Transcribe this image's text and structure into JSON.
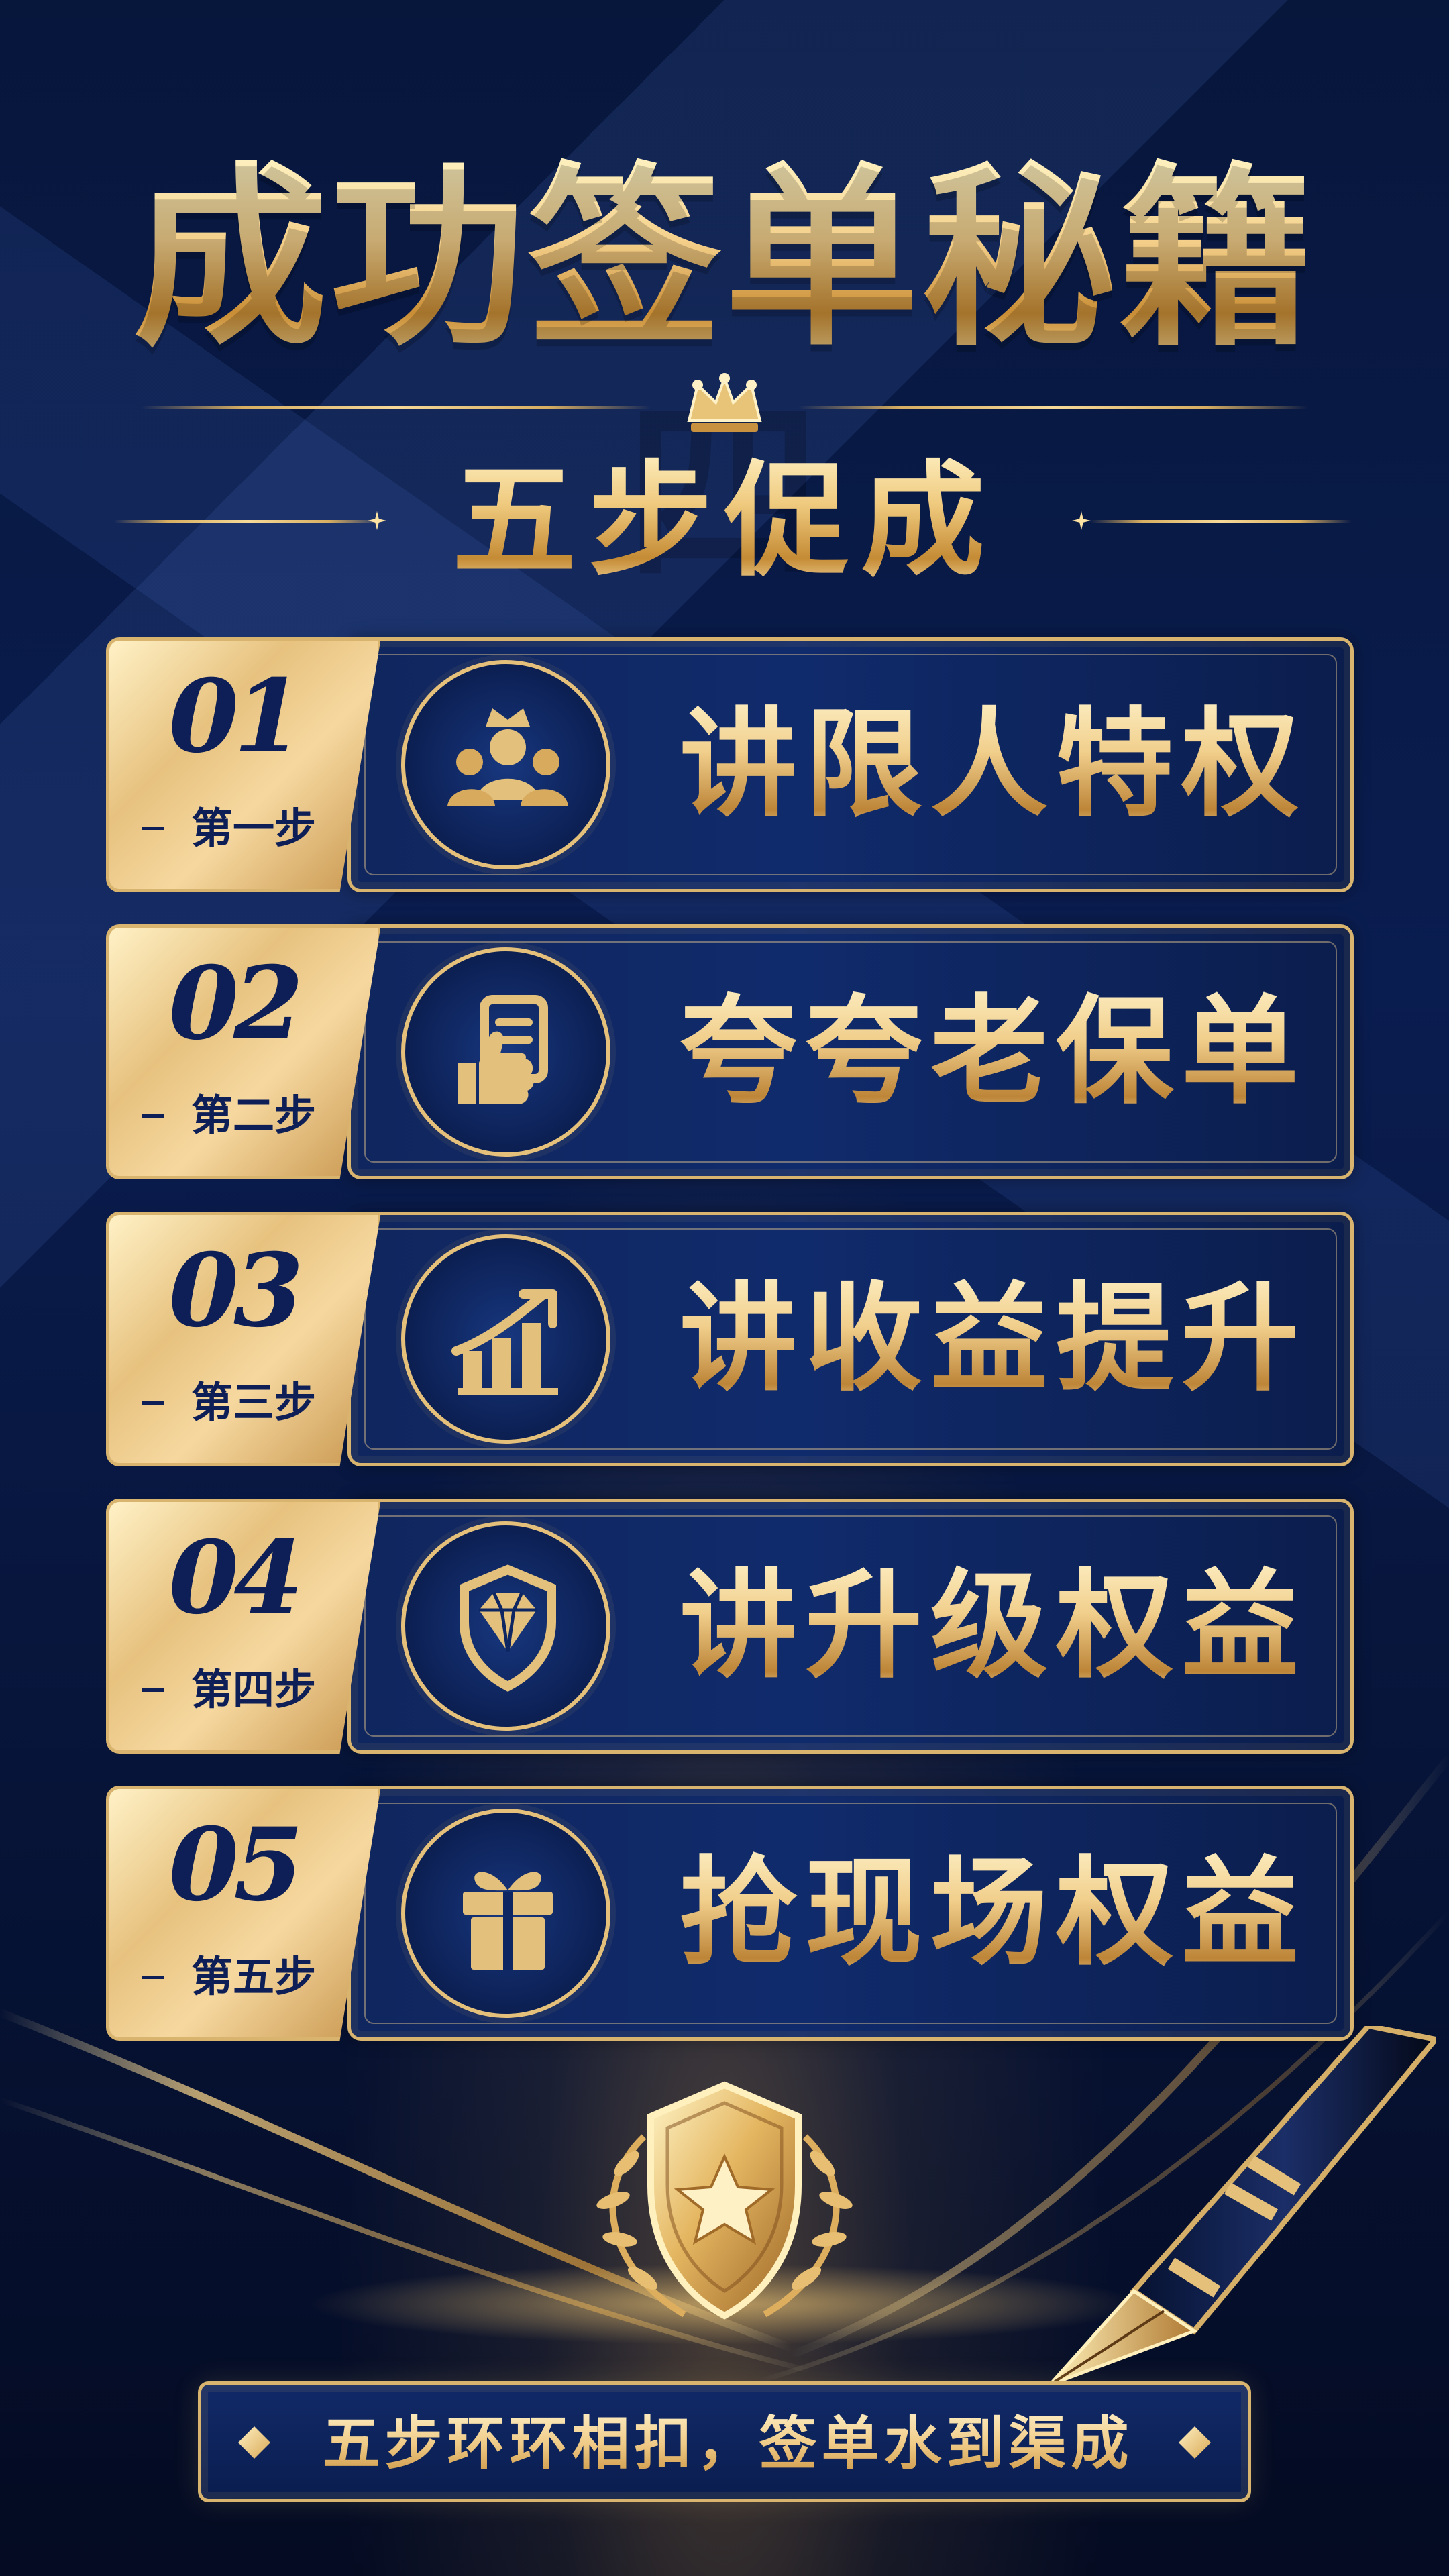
{
  "title": "成功签单秘籍四",
  "subtitle": "五步促成",
  "steps": [
    {
      "number": "01",
      "label": "第一步",
      "text": "讲限人特权",
      "icon": "crowned-group-icon"
    },
    {
      "number": "02",
      "label": "第二步",
      "text": "夸夸老保单",
      "icon": "thumbs-up-document-icon"
    },
    {
      "number": "03",
      "label": "第三步",
      "text": "讲收益提升",
      "icon": "growth-chart-icon"
    },
    {
      "number": "04",
      "label": "第四步",
      "text": "讲升级权益",
      "icon": "shield-diamond-icon"
    },
    {
      "number": "05",
      "label": "第五步",
      "text": "抢现场权益",
      "icon": "gift-icon"
    }
  ],
  "footer": {
    "text": "五步环环相扣，签单水到渠成"
  },
  "colors": {
    "navy": "#0d1f56",
    "gold": "#e4c07a",
    "light_gold": "#fff1c6"
  }
}
